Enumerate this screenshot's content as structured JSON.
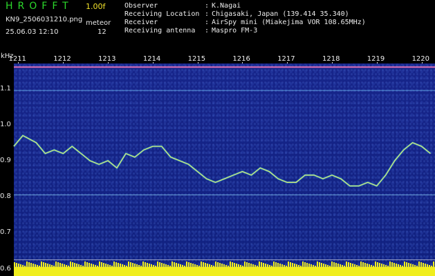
{
  "header": {
    "brand": "HROFFT",
    "version": "1.00f",
    "filename": "KN9_2506031210.png",
    "mode": "meteor",
    "datetime": "25.06.03 12:10",
    "count": "12",
    "meta": [
      {
        "label": "Observer",
        "value": "K.Nagai"
      },
      {
        "label": "Receiving Location",
        "value": "Chigasaki, Japan (139.414 35.340)"
      },
      {
        "label": "Receiver",
        "value": "AirSpy mini (Miakejima VOR 108.65MHz)"
      },
      {
        "label": "Receiving antenna",
        "value": "Maspro FM-3"
      }
    ]
  },
  "chart_data": {
    "type": "spectrogram",
    "ylabel": "kHz",
    "y_ticks": [
      "1.1",
      "1.0",
      "0.9",
      "0.8",
      "0.7",
      "0.6"
    ],
    "x_ticks": [
      "1211",
      "1212",
      "1213",
      "1214",
      "1215",
      "1216",
      "1217",
      "1218",
      "1219",
      "1220"
    ],
    "ylim": [
      0.58,
      1.17
    ],
    "xlim": [
      1210.9,
      1220.3
    ],
    "horizontal_lines_khz": [
      1.16,
      1.095,
      0.805,
      0.625,
      0.605
    ],
    "trace": {
      "x": [
        1210.9,
        1211.1,
        1211.4,
        1211.6,
        1211.8,
        1212.0,
        1212.2,
        1212.4,
        1212.6,
        1212.8,
        1213.0,
        1213.2,
        1213.4,
        1213.6,
        1213.8,
        1214.0,
        1214.2,
        1214.4,
        1214.6,
        1214.8,
        1215.0,
        1215.2,
        1215.4,
        1215.6,
        1215.8,
        1216.0,
        1216.2,
        1216.4,
        1216.6,
        1216.8,
        1217.0,
        1217.2,
        1217.4,
        1217.6,
        1217.8,
        1218.0,
        1218.2,
        1218.4,
        1218.6,
        1218.8,
        1219.0,
        1219.2,
        1219.4,
        1219.6,
        1219.8,
        1220.0,
        1220.2
      ],
      "y": [
        0.94,
        0.97,
        0.95,
        0.92,
        0.93,
        0.92,
        0.94,
        0.92,
        0.9,
        0.89,
        0.9,
        0.88,
        0.92,
        0.91,
        0.93,
        0.94,
        0.94,
        0.91,
        0.9,
        0.89,
        0.87,
        0.85,
        0.84,
        0.85,
        0.86,
        0.87,
        0.86,
        0.88,
        0.87,
        0.85,
        0.84,
        0.84,
        0.86,
        0.86,
        0.85,
        0.86,
        0.85,
        0.83,
        0.83,
        0.84,
        0.83,
        0.86,
        0.9,
        0.93,
        0.95,
        0.94,
        0.92
      ]
    }
  }
}
